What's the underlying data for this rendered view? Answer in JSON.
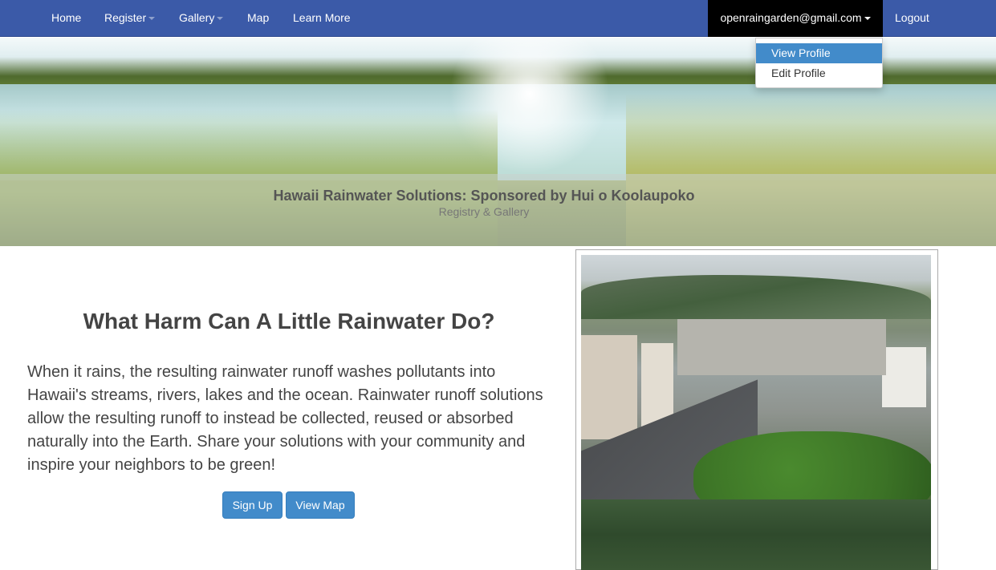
{
  "nav": {
    "home": "Home",
    "register": "Register",
    "gallery": "Gallery",
    "map": "Map",
    "learn_more": "Learn More",
    "user_email": "openraingarden@gmail.com",
    "logout": "Logout"
  },
  "user_dropdown": {
    "items": [
      "View Profile",
      "Edit Profile"
    ],
    "active_item": "View Profile"
  },
  "hero": {
    "title": "Hawaii Rainwater Solutions: Sponsored by Hui o Koolaupoko",
    "subtitle": "Registry & Gallery"
  },
  "main": {
    "heading": "What Harm Can A Little Rainwater Do?",
    "paragraph": "When it rains, the resulting rainwater runoff washes pollutants into Hawaii's streams, rivers, lakes and the ocean. Rainwater runoff solutions allow the resulting runoff to instead be collected, reused or absorbed naturally into the Earth. Share your solutions with your community and inspire your neighbors to be green!",
    "signup_button": "Sign Up",
    "viewmap_button": "View Map"
  },
  "colors": {
    "navbar": "#3b5aa8",
    "button": "#428bca",
    "dropdown_active": "#428bca",
    "user_menu_bg": "#000000"
  }
}
